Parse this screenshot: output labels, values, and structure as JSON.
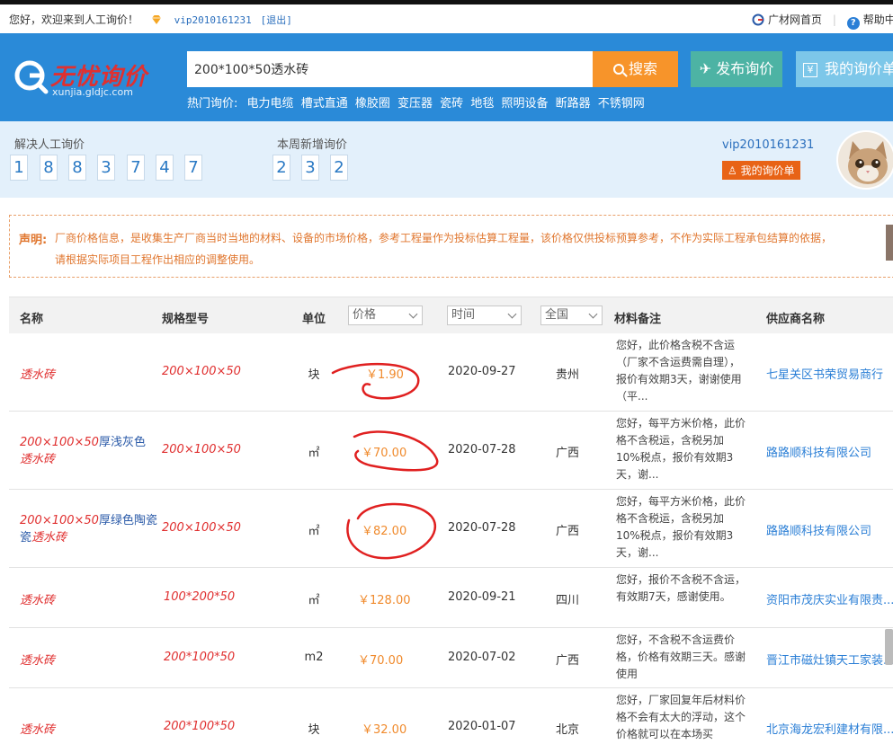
{
  "topbar": {
    "welcome": "您好，欢迎来到人工询价！",
    "vip_user": "vip2010161231",
    "logout": "[退出]",
    "home_link": "广材网首页",
    "help_link": "帮助中心"
  },
  "header": {
    "logo_name": "无忧询价",
    "logo_domain": "xunjia.gldjc.com",
    "search_value": "200*100*50透水砖",
    "search_button": "搜索",
    "post_button": "发布询价",
    "my_button": "我的询价单",
    "hot_label": "热门询价:",
    "hot_items": [
      "电力电缆",
      "槽式直通",
      "橡胶圈",
      "变压器",
      "瓷砖",
      "地毯",
      "照明设备",
      "断路器",
      "不锈钢网"
    ]
  },
  "stats": {
    "solved_label": "解决人工询价",
    "solved_digits": [
      "1",
      "8",
      "8",
      "3",
      "7",
      "4",
      "7"
    ],
    "weekly_label": "本周新增询价",
    "weekly_digits": [
      "2",
      "3",
      "2"
    ],
    "user": "vip2010161231",
    "my_list": "我的询价单"
  },
  "notice": {
    "title": "声明:",
    "line1": "厂商价格信息，是收集生产厂商当时当地的材料、设备的市场价格，参考工程量作为投标估算工程量，该价格仅供投标预算参考，不作为实际工程承包结算的依据，",
    "line2": "请根据实际项目工程作出相应的调整使用。"
  },
  "table": {
    "headers": {
      "name": "名称",
      "spec": "规格型号",
      "unit": "单位",
      "price_select": "价格",
      "time_select": "时间",
      "region_select": "全国",
      "note": "材料备注",
      "supplier": "供应商名称"
    },
    "rows": [
      {
        "name_red": "透水砖",
        "name_blue": "",
        "name_red2": "",
        "spec": "200×100×50",
        "unit": "块",
        "price": "￥1.90",
        "date": "2020-09-27",
        "region": "贵州",
        "note": "您好，此价格含税不含运（厂家不含运费需自理），报价有效期3天，谢谢使用（平...",
        "supplier": "七星关区书荣贸易商行"
      },
      {
        "name_red": "200×100×50",
        "name_blue": "厚浅灰色",
        "name_red2": "透水砖",
        "spec": "200×100×50",
        "unit": "㎡",
        "price": "￥70.00",
        "date": "2020-07-28",
        "region": "广西",
        "note": "您好，每平方米价格，此价格不含税运，含税另加10%税点，报价有效期3天，谢...",
        "supplier": "路路顺科技有限公司"
      },
      {
        "name_red": "200×100×50",
        "name_blue": "厚绿色陶瓷",
        "name_red2": "透水砖",
        "spec": "200×100×50",
        "unit": "㎡",
        "price": "￥82.00",
        "date": "2020-07-28",
        "region": "广西",
        "note": "您好，每平方米价格，此价格不含税运，含税另加10%税点，报价有效期3天，谢...",
        "supplier": "路路顺科技有限公司"
      },
      {
        "name_red": "透水砖",
        "name_blue": "",
        "name_red2": "",
        "spec": "100*200*50",
        "unit": "㎡",
        "price": "￥128.00",
        "date": "2020-09-21",
        "region": "四川",
        "note": "您好，报价不含税不含运，有效期7天，感谢使用。",
        "supplier": "资阳市茂庆实业有限责..."
      },
      {
        "name_red": "透水砖",
        "name_blue": "",
        "name_red2": "",
        "spec": "200*100*50",
        "unit": "m2",
        "price": "￥70.00",
        "date": "2020-07-02",
        "region": "广西",
        "note": "您好，不含税不含运费价格，价格有效期三天。感谢使用",
        "supplier": "晋江市磁灶镇天工家装..."
      },
      {
        "name_red": "透水砖",
        "name_blue": "",
        "name_red2": "",
        "spec": "200*100*50",
        "unit": "块",
        "price": "￥32.00",
        "date": "2020-01-07",
        "region": "北京",
        "note": "您好，厂家回复年后材料价格不会有太大的浮动，这个价格就可以在本场买",
        "supplier": "北京海龙宏利建材有限..."
      }
    ]
  },
  "colors": {
    "header_blue": "#2a8ad8",
    "search_orange": "#f7942a",
    "post_green": "#4db3a4",
    "price_orange": "#f08a2c",
    "link_blue": "#2b7fd6",
    "annotation_red": "#e02020"
  }
}
